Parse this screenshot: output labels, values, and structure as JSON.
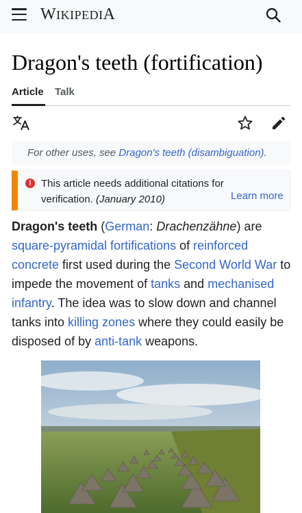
{
  "header": {
    "wordmark_first": "W",
    "wordmark_rest": "IKIPEDI",
    "wordmark_last": "A",
    "menu_icon": "hamburger-menu-icon",
    "search_icon": "search-icon"
  },
  "page": {
    "title": "Dragon's teeth (fortification)"
  },
  "tabs": [
    {
      "label": "Article",
      "active": true
    },
    {
      "label": "Talk",
      "active": false
    }
  ],
  "toolbar": {
    "language_icon": "language-icon",
    "watch_icon": "star-icon",
    "edit_icon": "pencil-icon"
  },
  "hatnote": {
    "prefix": "For other uses, see ",
    "link": "Dragon's teeth (disambiguation)",
    "suffix": "."
  },
  "notice": {
    "text": "This article needs additional citations for verification.",
    "date": "(January 2010)",
    "learn_more": "Learn more",
    "accent_color": "#f28500",
    "icon_color": "#dd3333"
  },
  "lead": {
    "term": "Dragon's teeth",
    "p1": " (",
    "link_german": "German",
    "p2": ": ",
    "native": "Drachenzähne",
    "p3": ") are ",
    "link_pyramid": "square-pyramidal fortifications",
    "p4": " of ",
    "link_concrete": "reinforced concrete",
    "p5": " first used during the ",
    "link_ww2": "Second World War",
    "p6": " to impede the movement of ",
    "link_tanks": "tanks",
    "p7": " and ",
    "link_infantry": "mechanised infantry",
    "p8": ". The idea was to slow down and channel tanks into ",
    "link_killing": "killing zones",
    "p9": " where they could easily be disposed of by ",
    "link_antitank": "anti-tank",
    "p10": " weapons."
  },
  "colors": {
    "link": "#3366cc",
    "header_bg": "#f8f9fa"
  }
}
